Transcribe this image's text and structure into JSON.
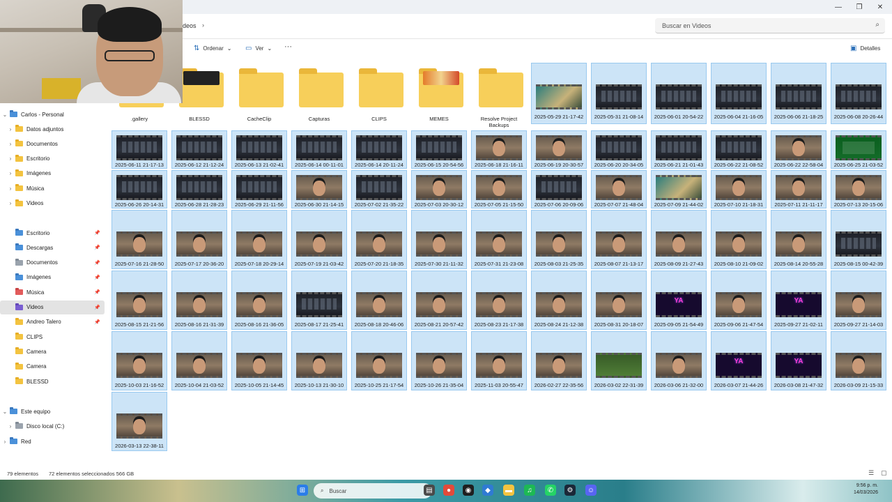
{
  "window": {
    "minimize": "—",
    "maximize": "❐",
    "close": "✕"
  },
  "address": {
    "crumb": "deos",
    "chevron": "›",
    "search_placeholder": "Buscar en Videos"
  },
  "toolbar": {
    "sort_label": "Ordenar",
    "view_label": "Ver",
    "more_label": "···",
    "details_label": "Detalles"
  },
  "sidebar": {
    "home_label": "Carlos - Personal",
    "tree": [
      {
        "label": "Datos adjuntos"
      },
      {
        "label": "Documentos"
      },
      {
        "label": "Escritorio"
      },
      {
        "label": "Imágenes"
      },
      {
        "label": "Música"
      },
      {
        "label": "Videos"
      }
    ],
    "quick": [
      {
        "label": "Escritorio",
        "icon": "blue",
        "pinned": true
      },
      {
        "label": "Descargas",
        "icon": "blue",
        "pinned": true
      },
      {
        "label": "Documentos",
        "icon": "gray",
        "pinned": true
      },
      {
        "label": "Imágenes",
        "icon": "blue",
        "pinned": true
      },
      {
        "label": "Música",
        "icon": "pink",
        "pinned": true
      },
      {
        "label": "Videos",
        "icon": "purple",
        "pinned": true,
        "selected": true
      },
      {
        "label": "Andreo Talero",
        "icon": "yellow",
        "pinned": true
      },
      {
        "label": "CLIPS",
        "icon": "yellow"
      },
      {
        "label": "Camera",
        "icon": "yellow"
      },
      {
        "label": "Camera",
        "icon": "yellow"
      },
      {
        "label": "BLESSD",
        "icon": "yellow"
      }
    ],
    "this_pc_label": "Este equipo",
    "disk_label": "Disco local (C:)",
    "network_label": "Red"
  },
  "folders": [
    {
      "name": ".gallery",
      "peek": "none"
    },
    {
      "name": "BLESSD",
      "peek": "dark"
    },
    {
      "name": "CacheClip",
      "peek": "none"
    },
    {
      "name": "Capturas",
      "peek": "none"
    },
    {
      "name": "CLIPS",
      "peek": "none"
    },
    {
      "name": "MEMES",
      "peek": "meme"
    },
    {
      "name": "Resolve Project Backups",
      "peek": "none"
    }
  ],
  "videos": [
    {
      "name": "2025-05-29 21-17-42",
      "thumb": "sea"
    },
    {
      "name": "2025-05-31 21-08-14",
      "thumb": "screen"
    },
    {
      "name": "2025-06-01 20-54-22",
      "thumb": "screen"
    },
    {
      "name": "2025-06-04 21-16-05",
      "thumb": "screen"
    },
    {
      "name": "2025-06-06 21-18-25",
      "thumb": "screen"
    },
    {
      "name": "2025-06-08 20-26-44",
      "thumb": "screen"
    },
    {
      "name": "2025-06-11 21-17-13",
      "thumb": "screen"
    },
    {
      "name": "2025-06-12 21-12-24",
      "thumb": "screen"
    },
    {
      "name": "2025-06-13 21-02-41",
      "thumb": "screen"
    },
    {
      "name": "2025-06-14 00-11-01",
      "thumb": "screen"
    },
    {
      "name": "2025-06-14 20-11-24",
      "thumb": "screen"
    },
    {
      "name": "2025-06-15 20-54-56",
      "thumb": "screen"
    },
    {
      "name": "2025-06-18 21-16-11",
      "thumb": "face"
    },
    {
      "name": "2025-06-19 20-30-57",
      "thumb": "face"
    },
    {
      "name": "2025-06-20 20-34-05",
      "thumb": "screen"
    },
    {
      "name": "2025-06-21 21-01-43",
      "thumb": "screen"
    },
    {
      "name": "2025-06-22 21-08-52",
      "thumb": "screen"
    },
    {
      "name": "2025-06-22 22-58-04",
      "thumb": "face"
    },
    {
      "name": "2025-06-25 21-03-52",
      "thumb": "mac"
    },
    {
      "name": "2025-06-26 20-14-31",
      "thumb": "screen"
    },
    {
      "name": "2025-06-28 21-28-23",
      "thumb": "screen"
    },
    {
      "name": "2025-06-29 21-11-56",
      "thumb": "screen"
    },
    {
      "name": "2025-06-30 21-14-15",
      "thumb": "face"
    },
    {
      "name": "2025-07-02 21-35-22",
      "thumb": "screen"
    },
    {
      "name": "2025-07-03 20-30-12",
      "thumb": "face"
    },
    {
      "name": "2025-07-05 21-15-50",
      "thumb": "face"
    },
    {
      "name": "2025-07-06 20-09-06",
      "thumb": "screen"
    },
    {
      "name": "2025-07-07 21-48-04",
      "thumb": "face"
    },
    {
      "name": "2025-07-09 21-44-02",
      "thumb": "sea"
    },
    {
      "name": "2025-07-10 21-18-31",
      "thumb": "face"
    },
    {
      "name": "2025-07-11 21-11-17",
      "thumb": "face"
    },
    {
      "name": "2025-07-13 20-15-06",
      "thumb": "face"
    },
    {
      "name": "2025-07-16 21-28-50",
      "thumb": "face"
    },
    {
      "name": "2025-07-17 20-36-20",
      "thumb": "face"
    },
    {
      "name": "2025-07-18 20-29-14",
      "thumb": "face"
    },
    {
      "name": "2025-07-19 21-03-42",
      "thumb": "face"
    },
    {
      "name": "2025-07-20 21-18-35",
      "thumb": "face"
    },
    {
      "name": "2025-07-30 21-11-32",
      "thumb": "face"
    },
    {
      "name": "2025-07-31 21-23-08",
      "thumb": "face"
    },
    {
      "name": "2025-08-03 21-25-35",
      "thumb": "face"
    },
    {
      "name": "2025-08-07 21-13-17",
      "thumb": "face"
    },
    {
      "name": "2025-08-09 21-27-43",
      "thumb": "face"
    },
    {
      "name": "2025-08-10 21-09-02",
      "thumb": "face"
    },
    {
      "name": "2025-08-14 20-55-28",
      "thumb": "face"
    },
    {
      "name": "2025-08-15 00-42-39",
      "thumb": "screen"
    },
    {
      "name": "2025-08-15 21-21-56",
      "thumb": "face"
    },
    {
      "name": "2025-08-16 21-31-39",
      "thumb": "face"
    },
    {
      "name": "2025-08-16 21-36-05",
      "thumb": "face"
    },
    {
      "name": "2025-08-17 21-25-41",
      "thumb": "screen"
    },
    {
      "name": "2025-08-18 20-46-06",
      "thumb": "face"
    },
    {
      "name": "2025-08-21 20-57-42",
      "thumb": "face"
    },
    {
      "name": "2025-08-23 21-17-38",
      "thumb": "face"
    },
    {
      "name": "2025-08-24 21-12-38",
      "thumb": "face"
    },
    {
      "name": "2025-08-31 20-18-07",
      "thumb": "face"
    },
    {
      "name": "2025-09-05 21-54-49",
      "thumb": "neon"
    },
    {
      "name": "2025-09-06 21-47-54",
      "thumb": "face"
    },
    {
      "name": "2025-09-27 21-02-11",
      "thumb": "neon"
    },
    {
      "name": "2025-09-27 21-14-03",
      "thumb": "face"
    },
    {
      "name": "2025-10-03 21-16-52",
      "thumb": "face"
    },
    {
      "name": "2025-10-04 21-03-52",
      "thumb": "face"
    },
    {
      "name": "2025-10-05 21-14-45",
      "thumb": "face"
    },
    {
      "name": "2025-10-13 21-30-10",
      "thumb": "face"
    },
    {
      "name": "2025-10-25 21-17-54",
      "thumb": "face"
    },
    {
      "name": "2025-10-26 21-35-04",
      "thumb": "face"
    },
    {
      "name": "2025-11-03 20-55-47",
      "thumb": "face"
    },
    {
      "name": "2026-02-27 22-35-56",
      "thumb": "face"
    },
    {
      "name": "2026-03-02 22-31-39",
      "thumb": "green"
    },
    {
      "name": "2026-03-06 21-32-00",
      "thumb": "face"
    },
    {
      "name": "2026-03-07 21-44-26",
      "thumb": "neon"
    },
    {
      "name": "2026-03-08 21-47-32",
      "thumb": "neon"
    },
    {
      "name": "2026-03-09 21-15-33",
      "thumb": "face"
    },
    {
      "name": "2026-03-13 22-38-11",
      "thumb": "face"
    }
  ],
  "status": {
    "count": "79 elementos",
    "selected": "72 elementos seleccionados  566 GB"
  },
  "taskbar": {
    "search_placeholder": "Buscar",
    "time": "9:56 p. m.",
    "date": "14/03/2026"
  },
  "colors": {
    "selection_bg": "#cce4f7",
    "selection_border": "#99c9ef",
    "folder": "#f7cf5a",
    "accent": "#2a6fb8"
  }
}
